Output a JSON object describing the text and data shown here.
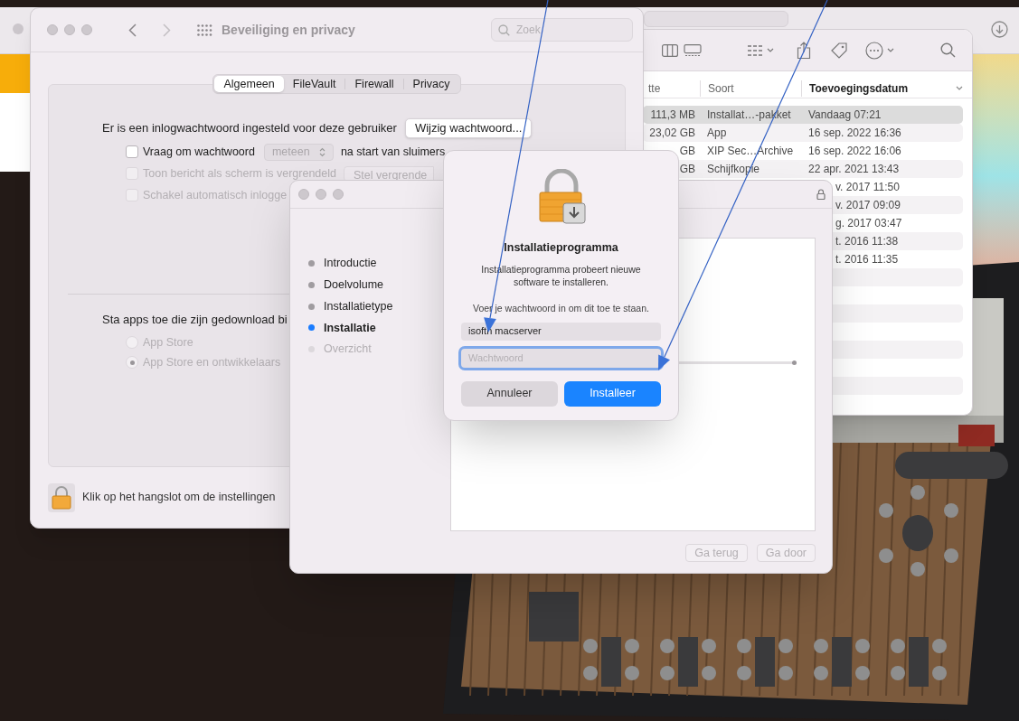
{
  "settings_window": {
    "title": "Beveiliging en privacy",
    "search": {
      "placeholder": "Zoek"
    },
    "tabs": [
      {
        "label": "Algemeen",
        "selected": true
      },
      {
        "label": "FileVault",
        "selected": false
      },
      {
        "label": "Firewall",
        "selected": false
      },
      {
        "label": "Privacy",
        "selected": false
      }
    ],
    "password_text": "Er is een inlogwachtwoord ingesteld voor deze gebruiker",
    "change_password_button": "Wijzig wachtwoord...",
    "options": [
      {
        "kind": "popup",
        "label": "Vraag om wachtwoord",
        "checked": false,
        "disabled": false,
        "popup": "meteen",
        "suffix": "na start van sluimers"
      },
      {
        "kind": "button",
        "label": "Toon bericht als scherm is vergrendeld",
        "checked": false,
        "disabled": true,
        "button": "Stel vergrende"
      },
      {
        "kind": "plain",
        "label": "Schakel automatisch inlogge",
        "checked": false,
        "disabled": true
      }
    ],
    "download_heading": "Sta apps toe die zijn gedownload bi",
    "download_options": [
      {
        "label": "App Store",
        "selected": false,
        "disabled": true
      },
      {
        "label": "App Store en ontwikkelaars",
        "selected": true,
        "disabled": true
      }
    ],
    "lock_text": "Klik op het hangslot om de instellingen"
  },
  "finder_window": {
    "columns": [
      {
        "label": "tte",
        "sorted": false
      },
      {
        "label": "Soort",
        "sorted": false
      },
      {
        "label": "Toevoegingsdatum",
        "sorted": true
      }
    ],
    "rows": [
      {
        "size": "111,3 MB",
        "soort": "Installat…-pakket",
        "date": "Vandaag 07:21",
        "selected": true,
        "covered": false
      },
      {
        "size": "23,02 GB",
        "soort": "App",
        "date": "16 sep. 2022 16:36",
        "selected": false,
        "covered": false
      },
      {
        "size": "GB",
        "soort": "XIP Sec…Archive",
        "date": "16 sep. 2022 16:06",
        "selected": false,
        "covered": false
      },
      {
        "size": "GB",
        "soort": "Schijfkopie",
        "date": "22 apr. 2021 13:43",
        "selected": false,
        "covered": false
      },
      {
        "date": "v. 2017 11:50",
        "selected": false,
        "covered": true
      },
      {
        "date": "v. 2017 09:09",
        "selected": false,
        "covered": true
      },
      {
        "date": "g. 2017 03:47",
        "selected": false,
        "covered": true
      },
      {
        "date": "t. 2016 11:38",
        "selected": false,
        "covered": true
      },
      {
        "date": "t. 2016 11:35",
        "selected": false,
        "covered": true
      }
    ]
  },
  "installer_window": {
    "steps": [
      {
        "label": "Introductie",
        "selected": false,
        "disabled": false
      },
      {
        "label": "Doelvolume",
        "selected": false,
        "disabled": false
      },
      {
        "label": "Installatietype",
        "selected": false,
        "disabled": false
      },
      {
        "label": "Installatie",
        "selected": true,
        "disabled": false
      },
      {
        "label": "Overzicht",
        "selected": false,
        "disabled": true
      }
    ],
    "buttons": [
      {
        "label": "Ga terug",
        "disabled": true
      },
      {
        "label": "Ga door",
        "disabled": true
      }
    ]
  },
  "auth_dialog": {
    "title": "Installatieprogramma",
    "message": "Installatieprogramma probeert nieuwe software te installeren.",
    "prompt": "Voer je wachtwoord in om dit toe te staan.",
    "username": "isofth macserver",
    "password": {
      "placeholder": "Wachtwoord",
      "focused": true
    },
    "buttons": [
      {
        "label": "Annuleer",
        "default": false
      },
      {
        "label": "Installeer",
        "default": true
      }
    ]
  }
}
